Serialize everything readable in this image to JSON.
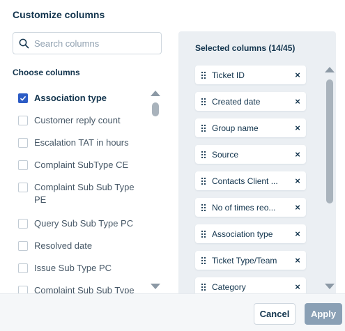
{
  "dialog": {
    "title": "Customize columns"
  },
  "search": {
    "placeholder": "Search columns"
  },
  "choose": {
    "label": "Choose columns",
    "items": [
      {
        "label": "Association type",
        "checked": true
      },
      {
        "label": "Customer reply count",
        "checked": false
      },
      {
        "label": "Escalation TAT in hours",
        "checked": false
      },
      {
        "label": "Complaint SubType CE",
        "checked": false
      },
      {
        "label": "Complaint Sub Sub Type PE",
        "checked": false
      },
      {
        "label": "Query Sub Sub Type PC",
        "checked": false
      },
      {
        "label": "Resolved date",
        "checked": false
      },
      {
        "label": "Issue Sub Type PC",
        "checked": false
      },
      {
        "label": "Complaint Sub Sub Type",
        "checked": false
      }
    ]
  },
  "selected": {
    "title": "Selected columns (14/45)",
    "items": [
      {
        "label": "Ticket ID"
      },
      {
        "label": "Created date"
      },
      {
        "label": "Group name"
      },
      {
        "label": "Source"
      },
      {
        "label": "Contacts Client ..."
      },
      {
        "label": "No of times reo..."
      },
      {
        "label": "Association type"
      },
      {
        "label": "Ticket Type/Team"
      },
      {
        "label": "Category"
      }
    ],
    "remove_glyph": "×"
  },
  "footer": {
    "cancel_label": "Cancel",
    "apply_label": "Apply"
  },
  "colors": {
    "accent": "#2c5cc5",
    "apply_disabled": "#8aa0b5",
    "pane_bg": "#ebeff3"
  },
  "icons": {
    "search": "search-icon",
    "check": "check-icon",
    "drag": "drag-handle-icon",
    "remove": "close-icon"
  }
}
